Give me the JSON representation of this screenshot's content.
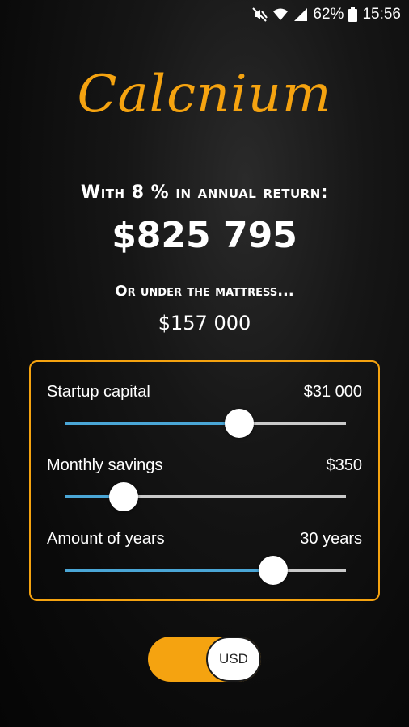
{
  "status_bar": {
    "battery": "62%",
    "time": "15:56",
    "icons": [
      "mute-icon",
      "wifi-icon",
      "signal-icon",
      "battery-icon"
    ]
  },
  "app": {
    "logo": "Calcnium",
    "accent_color": "#f5a310"
  },
  "summary": {
    "headline": "With 8 % in annual return:",
    "result": "$825 795",
    "subhead": "Or under the mattress...",
    "subvalue": "$157 000"
  },
  "inputs": {
    "startup_capital": {
      "label": "Startup capital",
      "value": "$31 000",
      "fraction": 0.62
    },
    "monthly_savings": {
      "label": "Monthly savings",
      "value": "$350",
      "fraction": 0.21
    },
    "years": {
      "label": "Amount of years",
      "value": "30 years",
      "fraction": 0.74
    }
  },
  "currency_toggle": {
    "label": "USD",
    "on": true
  }
}
